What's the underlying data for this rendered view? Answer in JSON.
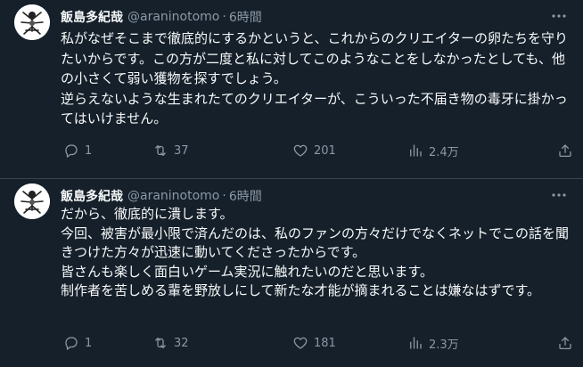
{
  "tweets": [
    {
      "display_name": "飯島多紀哉",
      "handle": "@araninotomo",
      "separator": "·",
      "time": "6時間",
      "text": "私がなぜそこまで徹底的にするかというと、これからのクリエイターの卵たちを守りたいからです。この方が二度と私に対してこのようなことをしなかったとしても、他の小さくて弱い獲物を探すでしょう。\n逆らえないような生まれたてのクリエイターが、こういった不届き物の毒牙に掛かってはいけません。",
      "replies": "1",
      "retweets": "37",
      "likes": "201",
      "views": "2.4万"
    },
    {
      "display_name": "飯島多紀哉",
      "handle": "@araninotomo",
      "separator": "·",
      "time": "6時間",
      "text": "だから、徹底的に潰します。\n今回、被害が最小限で済んだのは、私のファンの方々だけでなくネットでこの話を聞きつけた方々が迅速に動いてくださったからです。\n皆さんも楽しく面白いゲーム実況に触れたいのだと思います。\n制作者を苦しめる輩を野放しにして新たな才能が摘まれることは嫌なはずです。",
      "replies": "1",
      "retweets": "32",
      "likes": "181",
      "views": "2.3万"
    }
  ],
  "colors": {
    "background": "#15202b",
    "text": "#f7f9f9",
    "muted": "#8b98a5",
    "divider": "#38444d"
  },
  "icons": {
    "more": "more-horizontal-icon",
    "reply": "reply-icon",
    "retweet": "retweet-icon",
    "like": "heart-icon",
    "views": "analytics-icon",
    "share": "share-icon"
  }
}
